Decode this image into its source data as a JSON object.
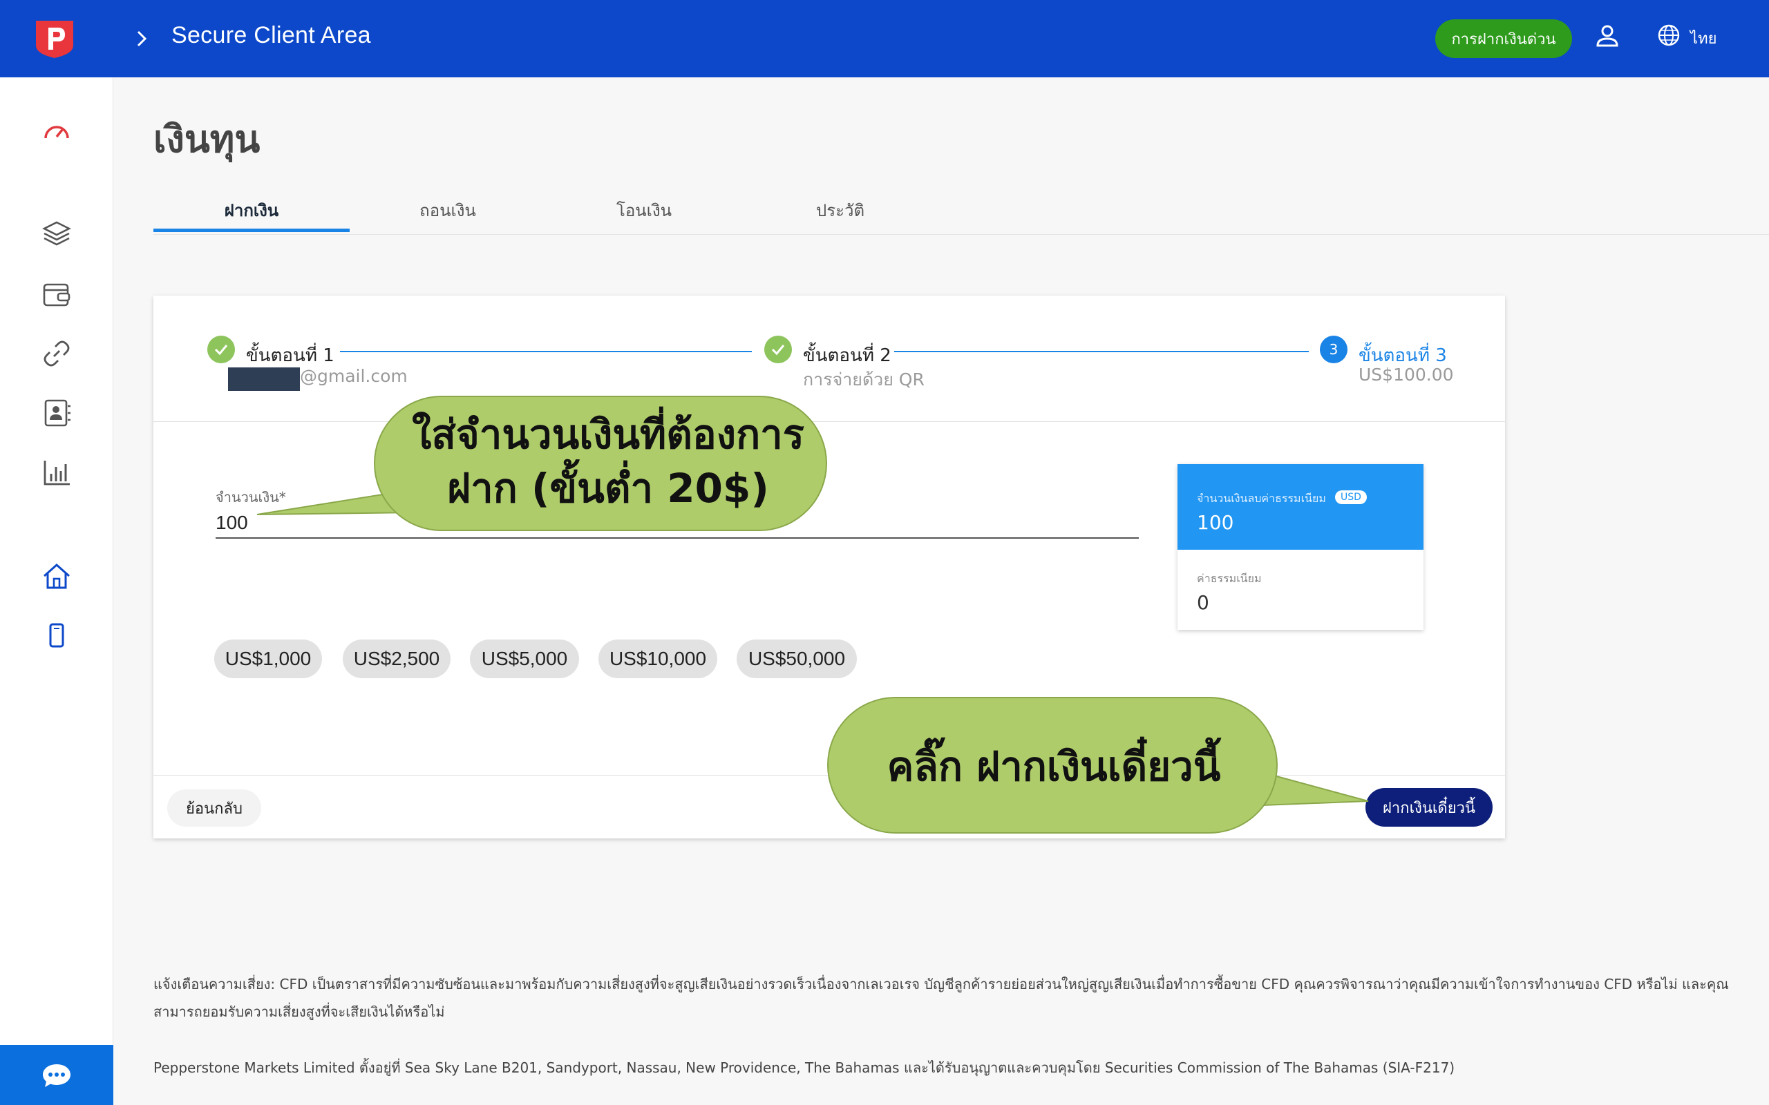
{
  "header": {
    "app_title": "Secure Client Area",
    "quick_deposit_label": "การฝากเงินด่วน",
    "language_label": "ไทย",
    "brand_color": "#0c48c9"
  },
  "page": {
    "title": "เงินทุน"
  },
  "tabs": [
    {
      "label": "ฝากเงิน",
      "active": true
    },
    {
      "label": "ถอนเงิน",
      "active": false
    },
    {
      "label": "โอนเงิน",
      "active": false
    },
    {
      "label": "ประวัติ",
      "active": false
    }
  ],
  "steps": [
    {
      "title": "ขั้นตอนที่ 1",
      "subtitle": "@gmail.com",
      "status": "done"
    },
    {
      "title": "ขั้นตอนที่ 2",
      "subtitle": "การจ่ายด้วย QR",
      "status": "done"
    },
    {
      "number": "3",
      "title": "ขั้นตอนที่ 3",
      "subtitle": "US$100.00",
      "status": "active"
    }
  ],
  "form": {
    "amount_label": "จำนวนเงิน*",
    "amount_value": "100"
  },
  "chips": [
    "US$1,000",
    "US$2,500",
    "US$5,000",
    "US$10,000",
    "US$50,000"
  ],
  "summary": {
    "net_label": "จำนวนเงินลบค่าธรรมเนียม",
    "currency_badge": "USD",
    "net_value": "100",
    "fee_label": "ค่าธรรมเนียม",
    "fee_value": "0"
  },
  "footer_buttons": {
    "back_label": "ย้อนกลับ",
    "deposit_label": "ฝากเงินเดี๋ยวนี้"
  },
  "callouts": {
    "amount_hint_line1": "ใส่จำนวนเงินที่ต้องการ",
    "amount_hint_line2": "ฝาก (ขั้นต่ำ 20$)",
    "click_hint": "คลิ๊ก ฝากเงินเดี๋ยวนี้"
  },
  "legal": {
    "risk_warning": "แจ้งเตือนความเสี่ยง: CFD เป็นตราสารที่มีความซับซ้อนและมาพร้อมกับความเสี่ยงสูงที่จะสูญเสียเงินอย่างรวดเร็วเนื่องจากเลเวอเรจ บัญชีลูกค้ารายย่อยส่วนใหญ่สูญเสียเงินเมื่อทำการซื้อขาย CFD คุณควรพิจารณาว่าคุณมีความเข้าใจการทำงานของ CFD หรือไม่ และคุณสามารถยอมรับความเสี่ยงสูงที่จะเสียเงินได้หรือไม่",
    "company_address": "Pepperstone Markets Limited ตั้งอยู่ที่ Sea Sky Lane B201, Sandyport, Nassau, New Providence, The Bahamas และได้รับอนุญาตและควบคุมโดย Securities Commission of The Bahamas (SIA-F217)"
  },
  "icons": {
    "logo": "pepperstone-logo",
    "sidebar": [
      "speedometer-icon",
      "layers-icon",
      "wallet-icon",
      "link-icon",
      "contacts-icon",
      "bar-chart-icon",
      "home-icon",
      "mobile-icon"
    ],
    "chat": "chat-icon"
  },
  "colors": {
    "accent_blue": "#1a84e6",
    "success_green": "#8dc45c",
    "deposit_button": "#0d1f7a",
    "callout_fill": "#afcc6b"
  }
}
